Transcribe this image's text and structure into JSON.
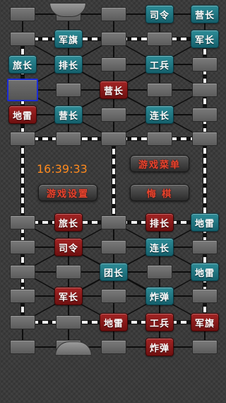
{
  "clock": "16:39:33",
  "buttons": {
    "game_menu": "游戏菜单",
    "game_settings": "游戏设置",
    "regret": "悔   棋"
  },
  "colors": {
    "teal_piece": "#1f7885",
    "red_piece": "#8b1818",
    "button_text": "#e8452e",
    "clock_text": "#ff8a1e",
    "selection": "#1b2bd6"
  },
  "pieces": [
    {
      "label": "司令",
      "side": "teal",
      "col": 3,
      "row": 0
    },
    {
      "label": "营长",
      "side": "teal",
      "col": 4,
      "row": 0
    },
    {
      "label": "军旗",
      "side": "teal",
      "col": 1,
      "row": 1
    },
    {
      "label": "军长",
      "side": "teal",
      "col": 4,
      "row": 1
    },
    {
      "label": "旅长",
      "side": "teal",
      "col": 0,
      "row": 2
    },
    {
      "label": "排长",
      "side": "teal",
      "col": 1,
      "row": 2
    },
    {
      "label": "工兵",
      "side": "teal",
      "col": 3,
      "row": 2
    },
    {
      "label": "营长",
      "side": "red",
      "col": 2,
      "row": 3
    },
    {
      "label": "地雷",
      "side": "red",
      "col": 0,
      "row": 4
    },
    {
      "label": "营长",
      "side": "teal",
      "col": 1,
      "row": 4
    },
    {
      "label": "连长",
      "side": "teal",
      "col": 3,
      "row": 4
    },
    {
      "label": "旅长",
      "side": "red",
      "col": 1,
      "row": 6
    },
    {
      "label": "排长",
      "side": "red",
      "col": 3,
      "row": 6
    },
    {
      "label": "地雷",
      "side": "teal",
      "col": 4,
      "row": 6
    },
    {
      "label": "司令",
      "side": "red",
      "col": 1,
      "row": 7
    },
    {
      "label": "连长",
      "side": "teal",
      "col": 3,
      "row": 7
    },
    {
      "label": "团长",
      "side": "teal",
      "col": 2,
      "row": 8
    },
    {
      "label": "地雷",
      "side": "teal",
      "col": 4,
      "row": 8
    },
    {
      "label": "军长",
      "side": "red",
      "col": 1,
      "row": 9
    },
    {
      "label": "炸弹",
      "side": "teal",
      "col": 3,
      "row": 9
    },
    {
      "label": "地雷",
      "side": "red",
      "col": 2,
      "row": 10
    },
    {
      "label": "工兵",
      "side": "red",
      "col": 3,
      "row": 10
    },
    {
      "label": "军旗",
      "side": "red",
      "col": 4,
      "row": 10
    },
    {
      "label": "炸弹",
      "side": "red",
      "col": 3,
      "row": 11
    }
  ],
  "selected": {
    "col": 0,
    "row": 3
  }
}
